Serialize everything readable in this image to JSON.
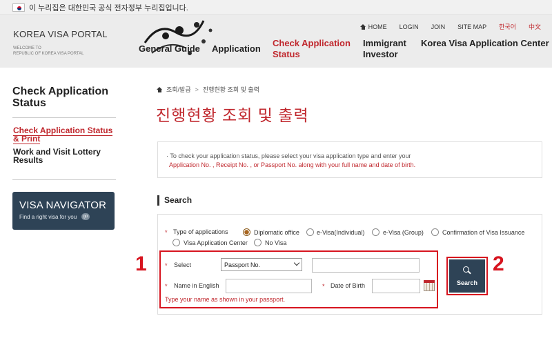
{
  "gov_banner": {
    "text": "이 누리집은 대한민국 공식 전자정부 누리집입니다."
  },
  "header": {
    "logo_title": "KOREA VISA PORTAL",
    "logo_sub_1": "WELCOME TO",
    "logo_sub_2": "REPUBLIC OF KOREA VISA PORTAL",
    "util": {
      "home": "HOME",
      "login": "LOGIN",
      "join": "JOIN",
      "sitemap": "SITE MAP",
      "lang_ko": "한국어",
      "lang_zh": "中文"
    },
    "nav": {
      "general": "General Guide",
      "application": "Application",
      "check_1": "Check Application",
      "check_2": "Status",
      "immigrant_1": "Immigrant",
      "immigrant_2": "Investor",
      "center": "Korea Visa Application Center"
    }
  },
  "sidebar": {
    "title_1": "Check Application",
    "title_2": "Status",
    "items": [
      {
        "line1": "Check Application Status",
        "line2": "& Print",
        "active": true
      },
      {
        "line1": "Work and Visit Lottery",
        "line2": "Results",
        "active": false
      }
    ],
    "banner": {
      "title": "VISA NAVIGATOR",
      "sub": "Find a right visa for you",
      "go": "go"
    }
  },
  "main": {
    "breadcrumb": {
      "first": "조회/발급",
      "sep": ">",
      "current": "진행현황 조회 및 출력"
    },
    "title": "진행현황 조회 및 출력",
    "notice_line1": "· To check your application status, please select your visa application type and enter your",
    "notice_line2": "Application No. , Receipt No. , or Passport No. along with your full name and date of birth.",
    "search_heading": "Search",
    "form": {
      "type_label": "Type of applications",
      "options": [
        {
          "label": "Diplomatic office",
          "selected": true
        },
        {
          "label": "e-Visa(Individual)",
          "selected": false
        },
        {
          "label": "e-Visa (Group)",
          "selected": false
        },
        {
          "label": "Confirmation of Visa Issuance",
          "selected": false
        },
        {
          "label": "Visa Application Center",
          "selected": false
        },
        {
          "label": "No Visa",
          "selected": false
        }
      ],
      "select_label": "Select",
      "select_value": "Passport No.",
      "name_label": "Name in English",
      "dob_label": "Date of Birth",
      "hint": "Type your name as shown in your passport.",
      "search_button": "Search"
    },
    "annotations": {
      "one": "1",
      "two": "2"
    }
  },
  "colors": {
    "accent": "#c0272d",
    "navy": "#2e4356",
    "highlight": "#d7141f"
  }
}
